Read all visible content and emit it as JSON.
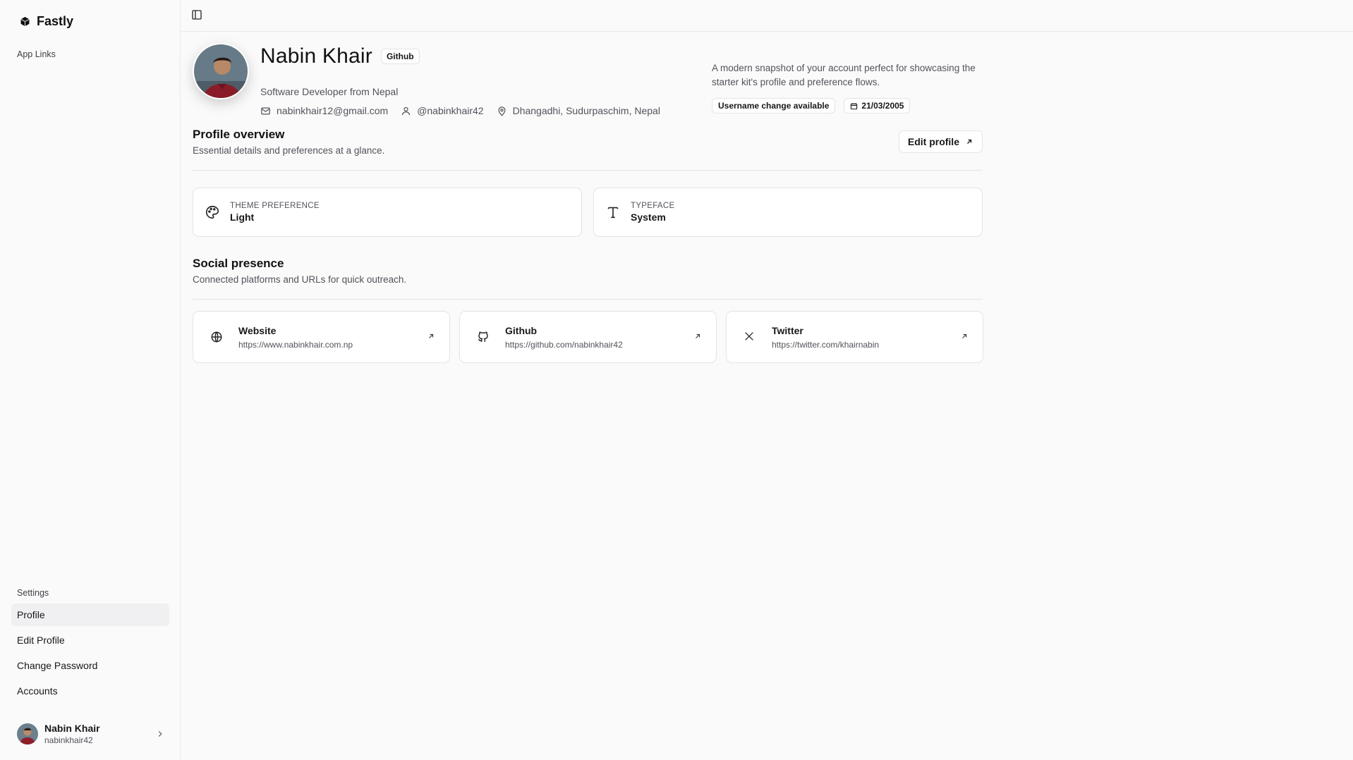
{
  "app": {
    "name": "Fastly"
  },
  "sidebar": {
    "group_app_links": "App Links",
    "group_settings": "Settings",
    "items": [
      {
        "label": "Profile",
        "active": true
      },
      {
        "label": "Edit Profile",
        "active": false
      },
      {
        "label": "Change Password",
        "active": false
      },
      {
        "label": "Accounts",
        "active": false
      }
    ],
    "user": {
      "name": "Nabin Khair",
      "handle": "nabinkhair42"
    }
  },
  "profile": {
    "name": "Nabin Khair",
    "badge": "Github",
    "role": "Software Developer from Nepal",
    "email": "nabinkhair12@gmail.com",
    "username": "@nabinkhair42",
    "location": "Dhangadhi, Sudurpaschim, Nepal",
    "blurb": "A modern snapshot of your account perfect for showcasing the starter kit's profile and preference flows.",
    "chips": {
      "username_change": "Username change available",
      "dob": "21/03/2005"
    }
  },
  "overview": {
    "title": "Profile overview",
    "subtitle": "Essential details and preferences at a glance.",
    "edit_label": "Edit profile",
    "preferences": [
      {
        "label": "THEME PREFERENCE",
        "value": "Light",
        "icon": "palette-icon"
      },
      {
        "label": "TYPEFACE",
        "value": "System",
        "icon": "type-icon"
      }
    ]
  },
  "social": {
    "title": "Social presence",
    "subtitle": "Connected platforms and URLs for quick outreach.",
    "links": [
      {
        "name": "Website",
        "url": "https://www.nabinkhair.com.np",
        "icon": "globe-icon"
      },
      {
        "name": "Github",
        "url": "https://github.com/nabinkhair42",
        "icon": "github-icon"
      },
      {
        "name": "Twitter",
        "url": "https://twitter.com/khairnabin",
        "icon": "x-icon"
      }
    ]
  }
}
